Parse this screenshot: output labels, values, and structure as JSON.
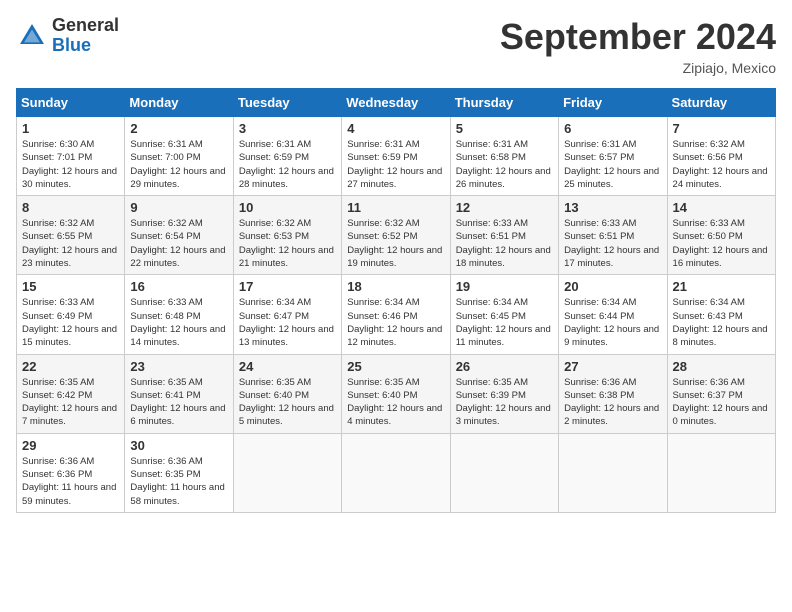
{
  "logo": {
    "general": "General",
    "blue": "Blue"
  },
  "title": "September 2024",
  "location": "Zipiajo, Mexico",
  "days_header": [
    "Sunday",
    "Monday",
    "Tuesday",
    "Wednesday",
    "Thursday",
    "Friday",
    "Saturday"
  ],
  "weeks": [
    [
      {
        "day": "1",
        "sunrise": "Sunrise: 6:30 AM",
        "sunset": "Sunset: 7:01 PM",
        "daylight": "Daylight: 12 hours and 30 minutes."
      },
      {
        "day": "2",
        "sunrise": "Sunrise: 6:31 AM",
        "sunset": "Sunset: 7:00 PM",
        "daylight": "Daylight: 12 hours and 29 minutes."
      },
      {
        "day": "3",
        "sunrise": "Sunrise: 6:31 AM",
        "sunset": "Sunset: 6:59 PM",
        "daylight": "Daylight: 12 hours and 28 minutes."
      },
      {
        "day": "4",
        "sunrise": "Sunrise: 6:31 AM",
        "sunset": "Sunset: 6:59 PM",
        "daylight": "Daylight: 12 hours and 27 minutes."
      },
      {
        "day": "5",
        "sunrise": "Sunrise: 6:31 AM",
        "sunset": "Sunset: 6:58 PM",
        "daylight": "Daylight: 12 hours and 26 minutes."
      },
      {
        "day": "6",
        "sunrise": "Sunrise: 6:31 AM",
        "sunset": "Sunset: 6:57 PM",
        "daylight": "Daylight: 12 hours and 25 minutes."
      },
      {
        "day": "7",
        "sunrise": "Sunrise: 6:32 AM",
        "sunset": "Sunset: 6:56 PM",
        "daylight": "Daylight: 12 hours and 24 minutes."
      }
    ],
    [
      {
        "day": "8",
        "sunrise": "Sunrise: 6:32 AM",
        "sunset": "Sunset: 6:55 PM",
        "daylight": "Daylight: 12 hours and 23 minutes."
      },
      {
        "day": "9",
        "sunrise": "Sunrise: 6:32 AM",
        "sunset": "Sunset: 6:54 PM",
        "daylight": "Daylight: 12 hours and 22 minutes."
      },
      {
        "day": "10",
        "sunrise": "Sunrise: 6:32 AM",
        "sunset": "Sunset: 6:53 PM",
        "daylight": "Daylight: 12 hours and 21 minutes."
      },
      {
        "day": "11",
        "sunrise": "Sunrise: 6:32 AM",
        "sunset": "Sunset: 6:52 PM",
        "daylight": "Daylight: 12 hours and 19 minutes."
      },
      {
        "day": "12",
        "sunrise": "Sunrise: 6:33 AM",
        "sunset": "Sunset: 6:51 PM",
        "daylight": "Daylight: 12 hours and 18 minutes."
      },
      {
        "day": "13",
        "sunrise": "Sunrise: 6:33 AM",
        "sunset": "Sunset: 6:51 PM",
        "daylight": "Daylight: 12 hours and 17 minutes."
      },
      {
        "day": "14",
        "sunrise": "Sunrise: 6:33 AM",
        "sunset": "Sunset: 6:50 PM",
        "daylight": "Daylight: 12 hours and 16 minutes."
      }
    ],
    [
      {
        "day": "15",
        "sunrise": "Sunrise: 6:33 AM",
        "sunset": "Sunset: 6:49 PM",
        "daylight": "Daylight: 12 hours and 15 minutes."
      },
      {
        "day": "16",
        "sunrise": "Sunrise: 6:33 AM",
        "sunset": "Sunset: 6:48 PM",
        "daylight": "Daylight: 12 hours and 14 minutes."
      },
      {
        "day": "17",
        "sunrise": "Sunrise: 6:34 AM",
        "sunset": "Sunset: 6:47 PM",
        "daylight": "Daylight: 12 hours and 13 minutes."
      },
      {
        "day": "18",
        "sunrise": "Sunrise: 6:34 AM",
        "sunset": "Sunset: 6:46 PM",
        "daylight": "Daylight: 12 hours and 12 minutes."
      },
      {
        "day": "19",
        "sunrise": "Sunrise: 6:34 AM",
        "sunset": "Sunset: 6:45 PM",
        "daylight": "Daylight: 12 hours and 11 minutes."
      },
      {
        "day": "20",
        "sunrise": "Sunrise: 6:34 AM",
        "sunset": "Sunset: 6:44 PM",
        "daylight": "Daylight: 12 hours and 9 minutes."
      },
      {
        "day": "21",
        "sunrise": "Sunrise: 6:34 AM",
        "sunset": "Sunset: 6:43 PM",
        "daylight": "Daylight: 12 hours and 8 minutes."
      }
    ],
    [
      {
        "day": "22",
        "sunrise": "Sunrise: 6:35 AM",
        "sunset": "Sunset: 6:42 PM",
        "daylight": "Daylight: 12 hours and 7 minutes."
      },
      {
        "day": "23",
        "sunrise": "Sunrise: 6:35 AM",
        "sunset": "Sunset: 6:41 PM",
        "daylight": "Daylight: 12 hours and 6 minutes."
      },
      {
        "day": "24",
        "sunrise": "Sunrise: 6:35 AM",
        "sunset": "Sunset: 6:40 PM",
        "daylight": "Daylight: 12 hours and 5 minutes."
      },
      {
        "day": "25",
        "sunrise": "Sunrise: 6:35 AM",
        "sunset": "Sunset: 6:40 PM",
        "daylight": "Daylight: 12 hours and 4 minutes."
      },
      {
        "day": "26",
        "sunrise": "Sunrise: 6:35 AM",
        "sunset": "Sunset: 6:39 PM",
        "daylight": "Daylight: 12 hours and 3 minutes."
      },
      {
        "day": "27",
        "sunrise": "Sunrise: 6:36 AM",
        "sunset": "Sunset: 6:38 PM",
        "daylight": "Daylight: 12 hours and 2 minutes."
      },
      {
        "day": "28",
        "sunrise": "Sunrise: 6:36 AM",
        "sunset": "Sunset: 6:37 PM",
        "daylight": "Daylight: 12 hours and 0 minutes."
      }
    ],
    [
      {
        "day": "29",
        "sunrise": "Sunrise: 6:36 AM",
        "sunset": "Sunset: 6:36 PM",
        "daylight": "Daylight: 11 hours and 59 minutes."
      },
      {
        "day": "30",
        "sunrise": "Sunrise: 6:36 AM",
        "sunset": "Sunset: 6:35 PM",
        "daylight": "Daylight: 11 hours and 58 minutes."
      },
      null,
      null,
      null,
      null,
      null
    ]
  ]
}
